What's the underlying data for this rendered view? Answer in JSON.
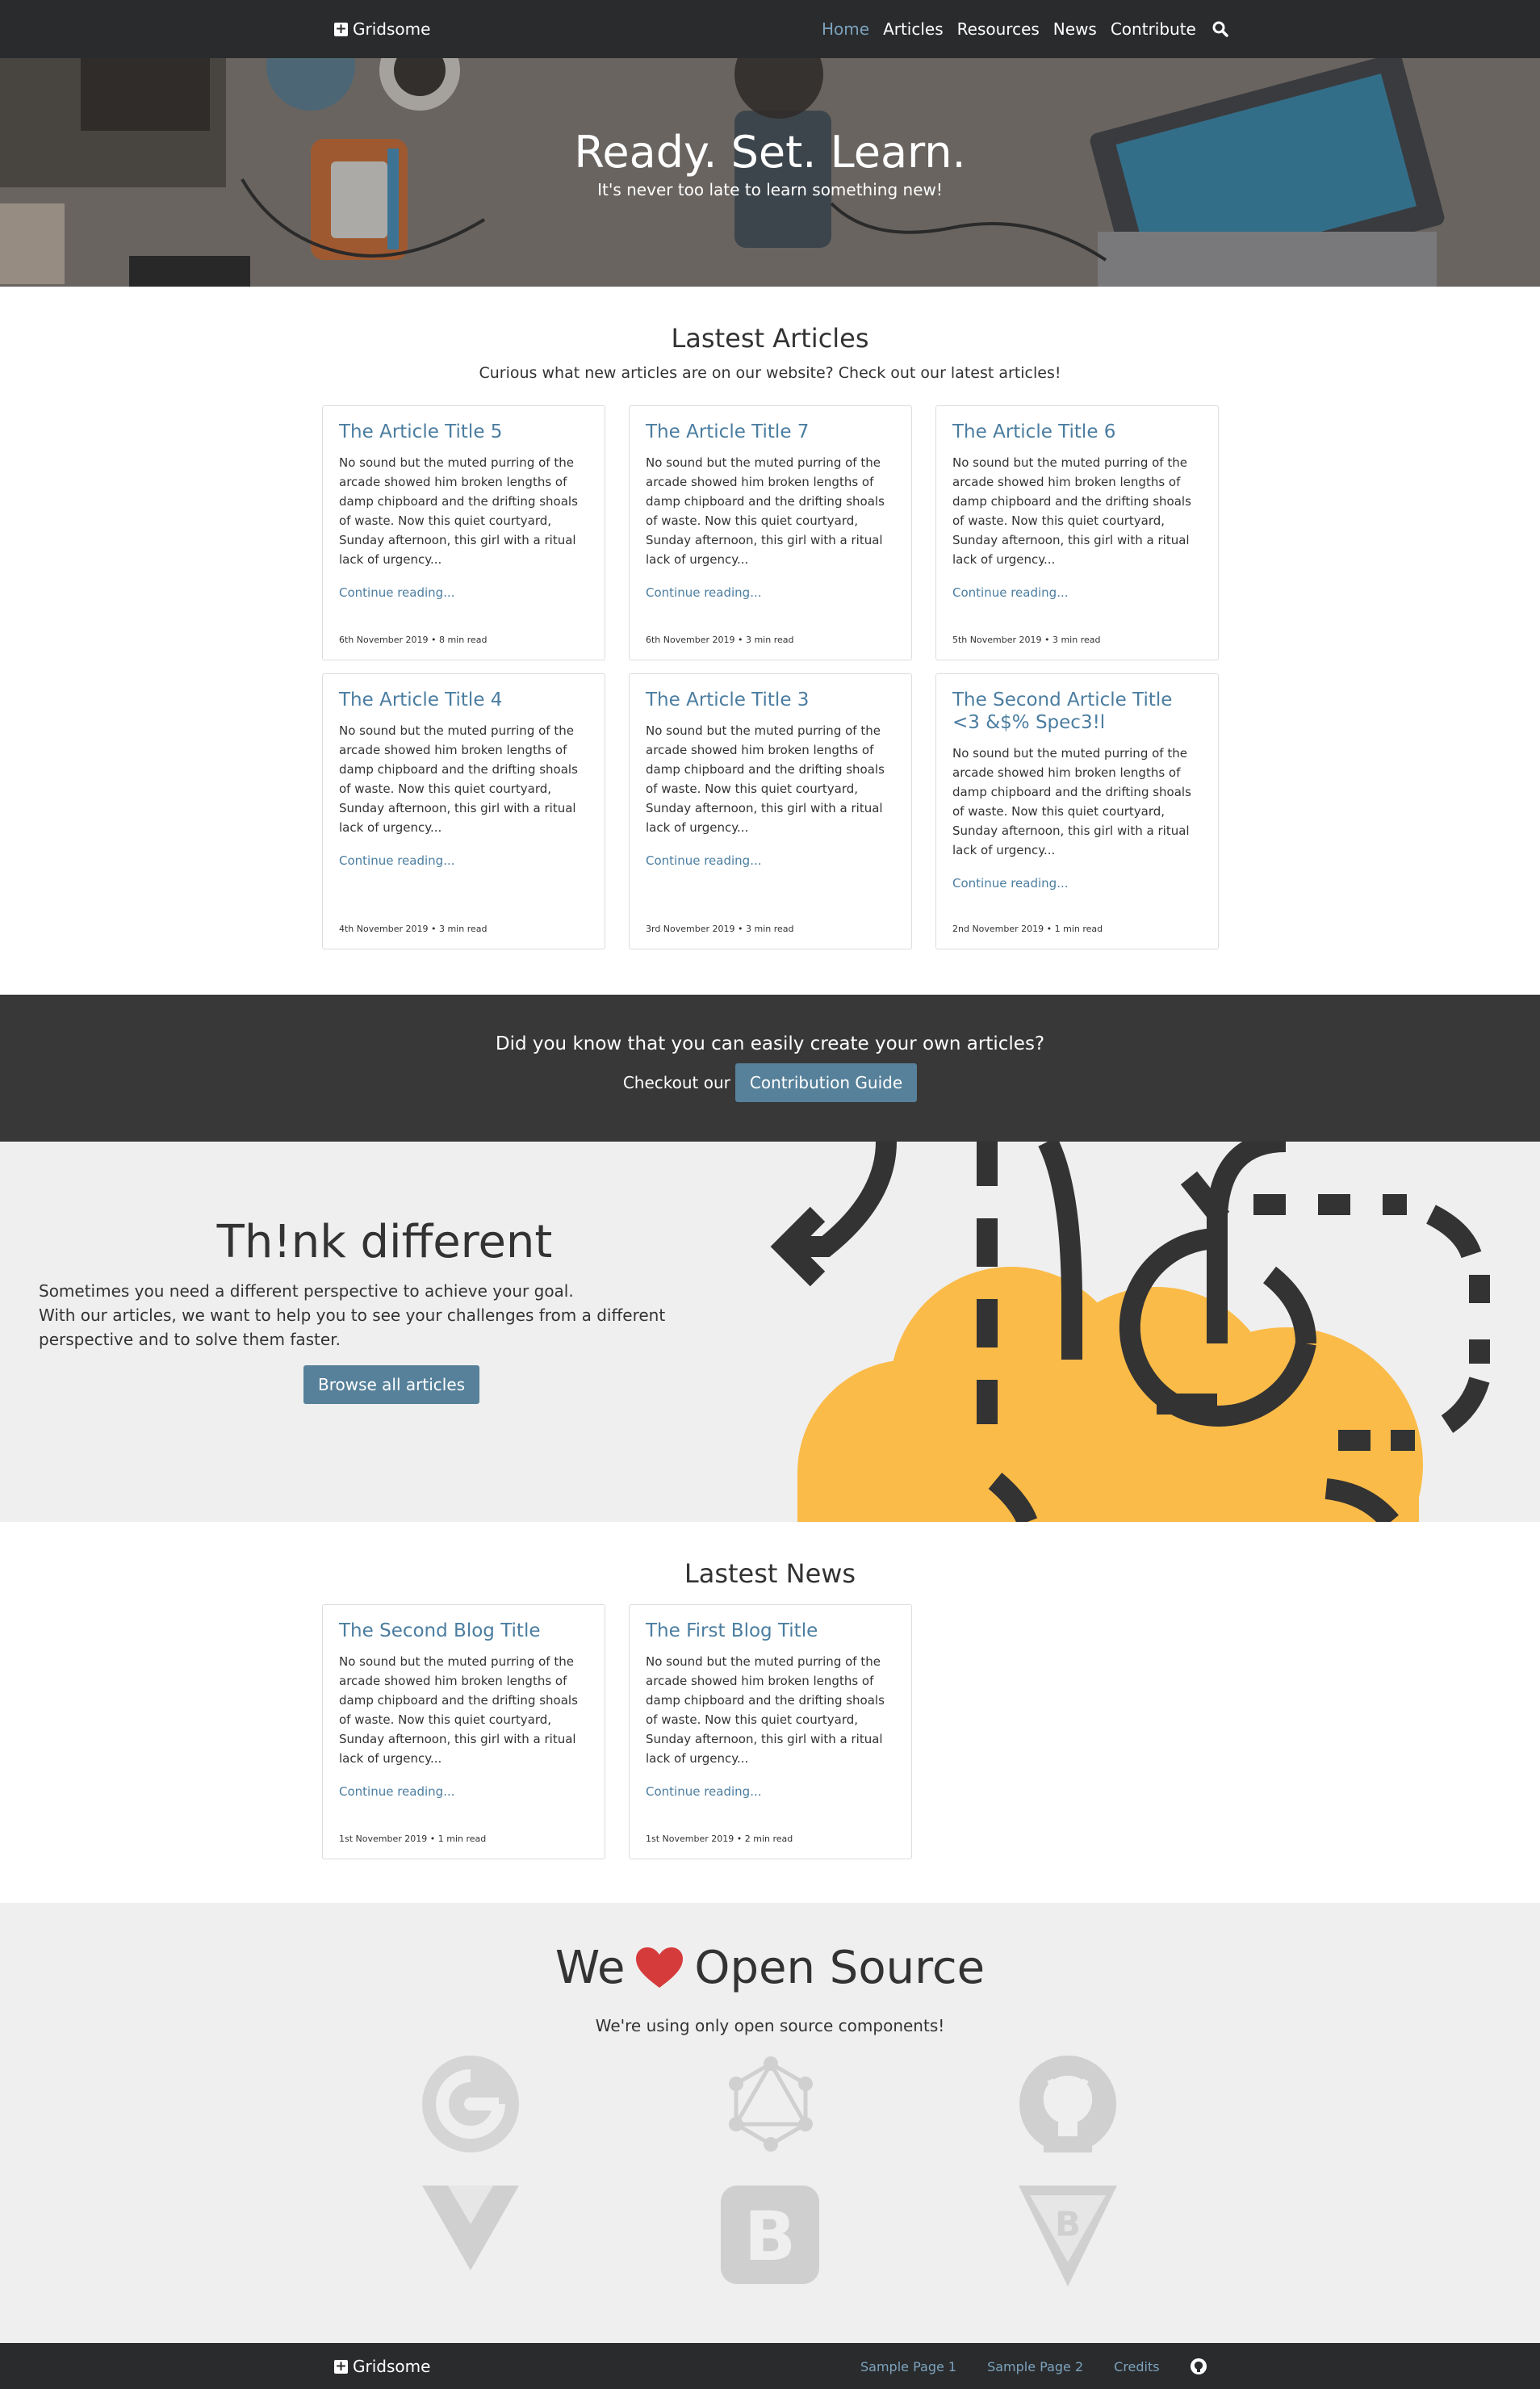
{
  "navbar": {
    "brand": "Gridsome",
    "links": [
      {
        "label": "Home",
        "active": true
      },
      {
        "label": "Articles"
      },
      {
        "label": "Resources"
      },
      {
        "label": "News"
      },
      {
        "label": "Contribute"
      }
    ],
    "search_icon": "search-icon"
  },
  "hero": {
    "title": "Ready. Set. Learn.",
    "subtitle": "It's never too late to learn something new!"
  },
  "articles": {
    "title": "Lastest Articles",
    "subtitle": "Curious what new articles are on our website? Check out our latest articles!",
    "items": [
      {
        "title": "The Article Title 5",
        "excerpt": "No sound but the muted purring of the arcade showed him broken lengths of damp chipboard and the drifting shoals of waste. Now this quiet courtyard, Sunday afternoon, this girl with a ritual lack of urgency...",
        "link": "Continue reading...",
        "meta": "6th November 2019 • 8 min read"
      },
      {
        "title": "The Article Title 7",
        "excerpt": "No sound but the muted purring of the arcade showed him broken lengths of damp chipboard and the drifting shoals of waste. Now this quiet courtyard, Sunday afternoon, this girl with a ritual lack of urgency...",
        "link": "Continue reading...",
        "meta": "6th November 2019 • 3 min read"
      },
      {
        "title": "The Article Title 6",
        "excerpt": "No sound but the muted purring of the arcade showed him broken lengths of damp chipboard and the drifting shoals of waste. Now this quiet courtyard, Sunday afternoon, this girl with a ritual lack of urgency...",
        "link": "Continue reading...",
        "meta": "5th November 2019 • 3 min read"
      },
      {
        "title": "The Article Title 4",
        "excerpt": "No sound but the muted purring of the arcade showed him broken lengths of damp chipboard and the drifting shoals of waste. Now this quiet courtyard, Sunday afternoon, this girl with a ritual lack of urgency...",
        "link": "Continue reading...",
        "meta": "4th November 2019 • 3 min read"
      },
      {
        "title": "The Article Title 3",
        "excerpt": "No sound but the muted purring of the arcade showed him broken lengths of damp chipboard and the drifting shoals of waste. Now this quiet courtyard, Sunday afternoon, this girl with a ritual lack of urgency...",
        "link": "Continue reading...",
        "meta": "3rd November 2019 • 3 min read"
      },
      {
        "title": "The Second Article Title <3 &$% Spec3!l",
        "excerpt": "No sound but the muted purring of the arcade showed him broken lengths of damp chipboard and the drifting shoals of waste. Now this quiet courtyard, Sunday afternoon, this girl with a ritual lack of urgency...",
        "link": "Continue reading...",
        "meta": "2nd November 2019 • 1 min read"
      }
    ]
  },
  "cta": {
    "question": "Did you know that you can easily create your own articles?",
    "prefix": "Checkout our",
    "button": "Contribution Guide"
  },
  "think": {
    "title": "Th!nk different",
    "lines": [
      "Sometimes you need a different perspective to achieve your goal.",
      "With our articles, we want to help you to see your challenges from a different perspective and to solve them faster."
    ],
    "button": "Browse all articles",
    "brain_color": "#fbbb48"
  },
  "news": {
    "title": "Lastest News",
    "items": [
      {
        "title": "The Second Blog Title",
        "excerpt": "No sound but the muted purring of the arcade showed him broken lengths of damp chipboard and the drifting shoals of waste. Now this quiet courtyard, Sunday afternoon, this girl with a ritual lack of urgency...",
        "link": "Continue reading...",
        "meta": "1st November 2019 • 1 min read"
      },
      {
        "title": "The First Blog Title",
        "excerpt": "No sound but the muted purring of the arcade showed him broken lengths of damp chipboard and the drifting shoals of waste. Now this quiet courtyard, Sunday afternoon, this girl with a ritual lack of urgency...",
        "link": "Continue reading...",
        "meta": "1st November 2019 • 2 min read"
      }
    ]
  },
  "opensource": {
    "title_before": "We",
    "title_after": "Open Source",
    "heart_color": "#d63b3b",
    "subtitle": "We're using only open source components!",
    "logos": [
      "gridsome-logo-icon",
      "graphql-logo-icon",
      "github-logo-icon",
      "vue-logo-icon",
      "bootstrap-logo-icon",
      "bootstrap-vue-logo-icon"
    ]
  },
  "footer": {
    "brand": "Gridsome",
    "links": [
      "Sample Page 1",
      "Sample Page 2",
      "Credits"
    ],
    "github_icon": "github-icon"
  },
  "colors": {
    "navbar": "#2a2b2d",
    "accent_link": "#4b7da0",
    "button": "#57819a",
    "cta_bg": "#383838",
    "section_gray": "#efefef"
  }
}
